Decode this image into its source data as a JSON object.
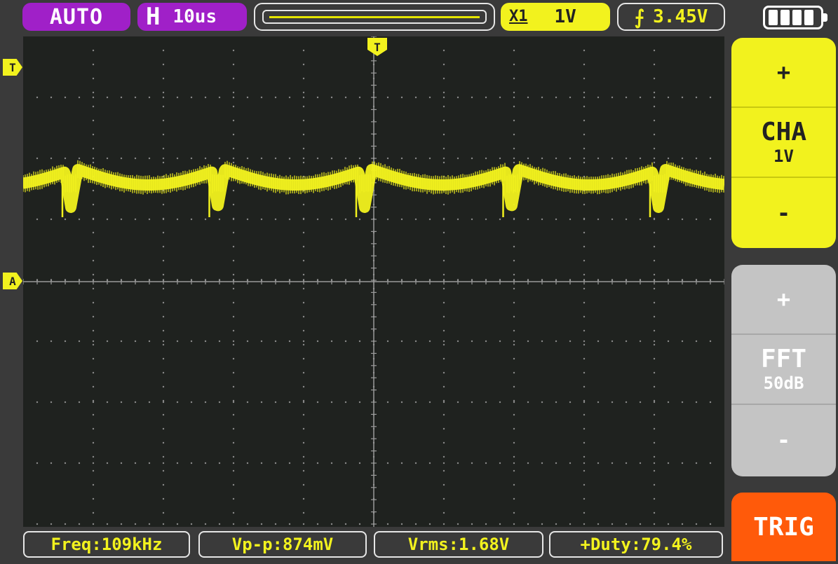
{
  "topbar": {
    "mode": "AUTO",
    "timebase_letter": "H",
    "timebase_value": "10us",
    "channel_coupling": "X1",
    "channel_scale": "1V",
    "trigger_edge_icon": "rising-edge-icon",
    "trigger_level": "3.45V",
    "battery_level": 1.0
  },
  "markers": {
    "trigger_position": "T",
    "trigger_level": "T",
    "channel": "A"
  },
  "side": {
    "cha": {
      "plus": "+",
      "name": "CHA",
      "value": "1V",
      "minus": "-"
    },
    "fft": {
      "plus": "+",
      "name": "FFT",
      "value": "50dB",
      "minus": "-"
    },
    "trig": "TRIG"
  },
  "measurements": {
    "freq": "Freq:109kHz",
    "vpp": "Vp-p:874mV",
    "vrms": "Vrms:1.68V",
    "duty": "+Duty:79.4%"
  },
  "colors": {
    "trace": "#f2f21e",
    "mode_bg": "#a020c8",
    "trig_bg": "#ff5a0a",
    "fft_bg": "#c4c4c4",
    "screen_bg": "#1f221f"
  }
}
